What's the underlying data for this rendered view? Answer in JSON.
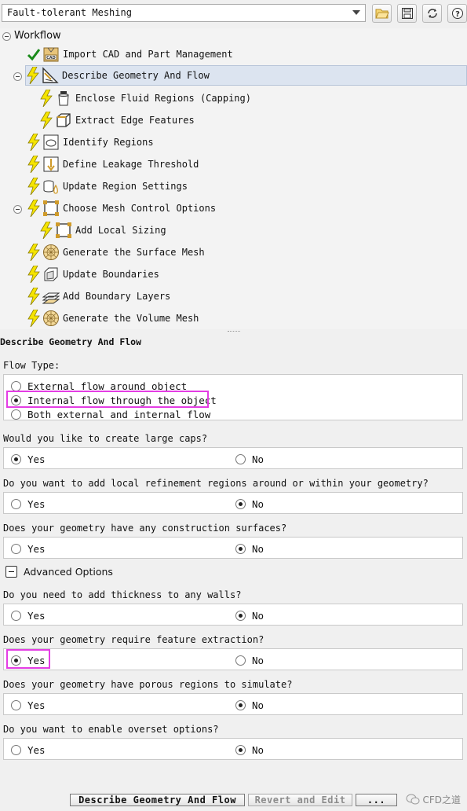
{
  "toolbar": {
    "workflow_select": "Fault-tolerant Meshing",
    "icons": [
      "folder-open-icon",
      "save-icon",
      "refresh-icon",
      "help-icon"
    ]
  },
  "tree": {
    "root": "Workflow",
    "tasks": [
      {
        "label": "Import CAD and Part Management",
        "status": "check"
      },
      {
        "label": "Describe Geometry And Flow",
        "status": "bolt"
      },
      {
        "label": "Enclose Fluid Regions (Capping)",
        "status": "bolt"
      },
      {
        "label": "Extract Edge Features",
        "status": "bolt"
      },
      {
        "label": "Identify Regions",
        "status": "bolt"
      },
      {
        "label": "Define Leakage Threshold",
        "status": "bolt"
      },
      {
        "label": "Update Region Settings",
        "status": "bolt"
      },
      {
        "label": "Choose Mesh Control Options",
        "status": "bolt"
      },
      {
        "label": "Add Local Sizing",
        "status": "bolt"
      },
      {
        "label": "Generate the Surface Mesh",
        "status": "bolt"
      },
      {
        "label": "Update Boundaries",
        "status": "bolt"
      },
      {
        "label": "Add Boundary Layers",
        "status": "bolt"
      },
      {
        "label": "Generate the Volume Mesh",
        "status": "bolt"
      }
    ]
  },
  "panel": {
    "title": "Describe Geometry And Flow",
    "flow_type": {
      "label": "Flow Type:",
      "options": [
        "External flow around object",
        "Internal flow through the object",
        "Both external and internal flow"
      ],
      "selected": "Internal flow through the object"
    },
    "large_caps": {
      "question": "Would you like to create large caps?",
      "selected": "Yes"
    },
    "local_refinement": {
      "question": "Do you want to add local refinement regions around or within your geometry?",
      "selected": "No"
    },
    "construction_surfaces": {
      "question": "Does your geometry have any construction surfaces?",
      "selected": "No"
    },
    "advanced_options": "Advanced Options",
    "thickness": {
      "question": "Do you need to add thickness to any walls?",
      "selected": "No"
    },
    "feature_extraction": {
      "question": "Does your geometry require feature extraction?",
      "selected": "Yes"
    },
    "porous_regions": {
      "question": "Does your geometry have porous regions to simulate?",
      "selected": "No"
    },
    "overset": {
      "question": "Do you want to enable overset options?",
      "selected": "No"
    },
    "yes_label": "Yes",
    "no_label": "No"
  },
  "bottom": {
    "primary_button": "Describe Geometry And Flow",
    "revert_button": "Revert and Edit",
    "more_button": "...",
    "watermark": "CFD之道"
  },
  "colors": {
    "highlight": "#e43de4",
    "bolt": "#f5e400",
    "check": "#1a8a1a"
  }
}
